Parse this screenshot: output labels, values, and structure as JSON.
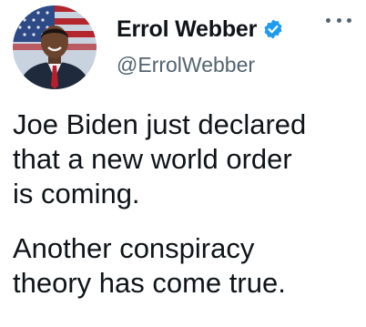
{
  "author": {
    "display_name": "Errol Webber",
    "handle": "@ErrolWebber",
    "verified": true
  },
  "icons": {
    "verified": "verified-badge-icon",
    "more": "more-options-icon",
    "avatar": "profile-photo"
  },
  "colors": {
    "verified_blue": "#1d9bf0",
    "text": "#0f1419",
    "secondary": "#536471"
  },
  "tweet": {
    "paragraph_1": "Joe Biden just declared\nthat a new world order\nis coming.",
    "paragraph_2": "Another conspiracy\ntheory has come true."
  }
}
